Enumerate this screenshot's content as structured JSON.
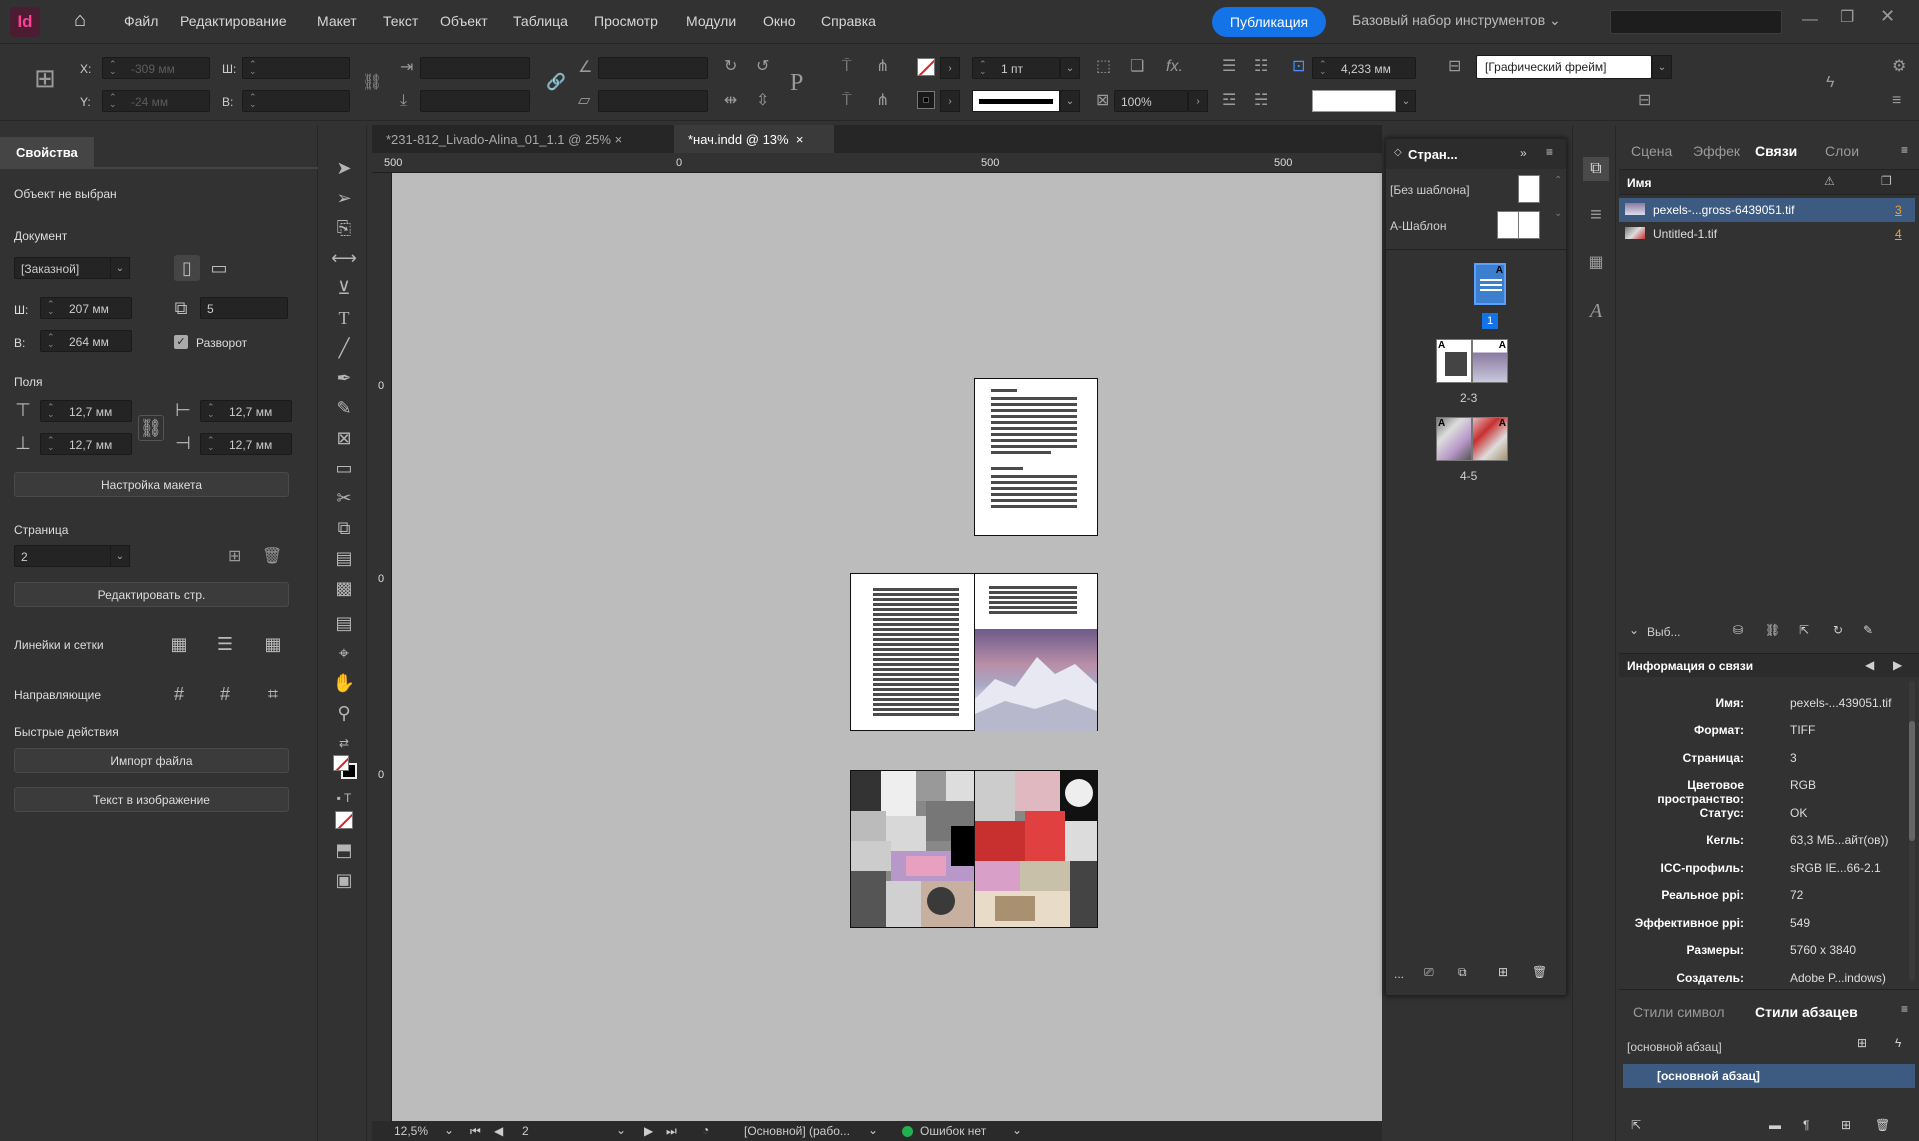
{
  "app": {
    "logo": "Id",
    "home_icon": "home-icon"
  },
  "menu": [
    "Файл",
    "Редактирование",
    "Макет",
    "Текст",
    "Объект",
    "Таблица",
    "Просмотр",
    "Модули",
    "Окно",
    "Справка"
  ],
  "publish_label": "Публикация",
  "workspace": "Базовый набор инструментов",
  "control": {
    "x_label": "X:",
    "y_label": "Y:",
    "x_value": "-309 мм",
    "y_value": "-24 мм",
    "w_label": "Ш:",
    "h_label": "В:",
    "stroke_weight": "1 пт",
    "scale": "100%",
    "gap": "4,233 мм",
    "object_style": "[Графический фрейм]"
  },
  "left_panel": {
    "tab": "Свойства",
    "no_selection": "Объект не выбран",
    "document_title": "Документ",
    "preset": "[Заказной]",
    "w_label": "Ш:",
    "w_value": "207 мм",
    "h_label": "В:",
    "h_value": "264 мм",
    "pages_count": "5",
    "facing_label": "Разворот",
    "margins_title": "Поля",
    "margin_top": "12,7 мм",
    "margin_bottom": "12,7 мм",
    "margin_left": "12,7 мм",
    "margin_right": "12,7 мм",
    "layout_btn": "Настройка макета",
    "page_title": "Страница",
    "page_value": "2",
    "edit_page_btn": "Редактировать стр.",
    "rulers_title": "Линейки и сетки",
    "guides_title": "Направляющие",
    "quick_title": "Быстрые действия",
    "import_btn": "Импорт файла",
    "text_to_image_btn": "Текст в изображение"
  },
  "doc_tabs": [
    {
      "label": "*231-812_Livado-Alina_01_1.1 @ 25%",
      "close": "×"
    },
    {
      "label": "*нач.indd @ 13%",
      "close": "×"
    }
  ],
  "ruler": {
    "top_a": "500",
    "top_b": "0",
    "top_c": "500",
    "top_d": "500",
    "left_a": "0",
    "left_b": "0",
    "left_c": "0"
  },
  "status": {
    "zoom": "12,5%",
    "page": "2",
    "style": "[Основной] (рабо...",
    "errors": "Ошибок нет"
  },
  "pages_panel": {
    "title": "Стран...",
    "none_master": "[Без шаблона]",
    "a_master": "A-Шаблон",
    "page_1": "1",
    "spread_2": "2-3",
    "spread_3": "4-5",
    "more": "...",
    "a_badge": "A"
  },
  "right_panel": {
    "tabs": [
      "Сцена",
      "Эффек",
      "Связи",
      "Слои"
    ],
    "col_name": "Имя",
    "links": [
      {
        "name": "pexels-...gross-6439051.tif",
        "page": "3"
      },
      {
        "name": "Untitled-1.tif",
        "page": "4"
      }
    ],
    "selected_label": "Выб...",
    "info_title": "Информация о связи",
    "info": [
      {
        "k": "Имя:",
        "v": "pexels-...439051.tif"
      },
      {
        "k": "Формат:",
        "v": "TIFF"
      },
      {
        "k": "Страница:",
        "v": "3"
      },
      {
        "k": "Цветовое пространство:",
        "v": "RGB"
      },
      {
        "k": "Статус:",
        "v": "OK"
      },
      {
        "k": "Кегль:",
        "v": "63,3 МБ...айт(ов))"
      },
      {
        "k": "ICC-профиль:",
        "v": "sRGB IE...66-2.1"
      },
      {
        "k": "Реальное ppi:",
        "v": "72"
      },
      {
        "k": "Эффективное ppi:",
        "v": "549"
      },
      {
        "k": "Размеры:",
        "v": "5760 x 3840"
      },
      {
        "k": "Создатель:",
        "v": "Adobe P...indows)"
      }
    ],
    "styles_tabs": [
      "Стили символ",
      "Стили абзацев"
    ],
    "current_style": "[основной абзац]",
    "style_item": "[основной абзац]"
  },
  "colors": {
    "accent": "#1473e6",
    "selection": "#3d5a80",
    "canvas": "#bcbcbc",
    "status_ok": "#22b14c"
  }
}
